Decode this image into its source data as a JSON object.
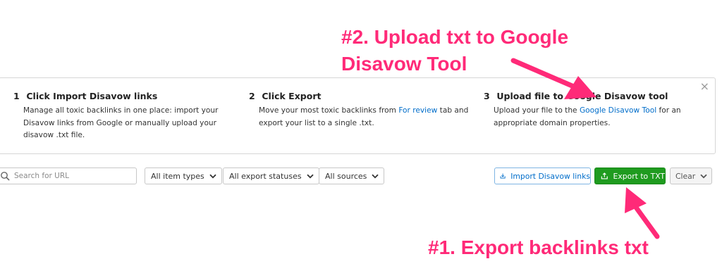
{
  "panel": {
    "steps": [
      {
        "num": "1",
        "title": "Click Import Disavow links",
        "lines": [
          "Manage all toxic backlinks in one place: import your",
          "Disavow links from Google or manually upload your",
          "disavow .txt file."
        ]
      },
      {
        "num": "2",
        "title": "Click Export",
        "line1_pre": "Move your most toxic backlinks from ",
        "line1_link": "For review",
        "line1_post": " tab and",
        "line2": "export your list to a single .txt."
      },
      {
        "num": "3",
        "title": "Upload file to Google Disavow tool",
        "line1_pre": "Upload your file to the ",
        "line1_link": "Google Disavow Tool",
        "line1_post": " for an",
        "line2": "appropriate domain properties."
      }
    ],
    "close_symbol": "×"
  },
  "toolbar": {
    "search_placeholder": "Search for URL",
    "filters": [
      "All item types",
      "All export statuses",
      "All sources"
    ],
    "import_label": "Import Disavow links",
    "export_label": "Export to TXT",
    "clear_label": "Clear"
  },
  "annotations": {
    "upload_line1": "#2. Upload txt to Google",
    "upload_line2": "Disavow Tool",
    "export": "#1. Export backlinks txt"
  },
  "colors": {
    "accent_link": "#006dca",
    "export_button": "#1f9b1f",
    "annotation": "#ff2a78"
  },
  "icons": [
    "search-icon",
    "chevron-down-icon",
    "import-icon",
    "export-icon",
    "close-icon"
  ]
}
